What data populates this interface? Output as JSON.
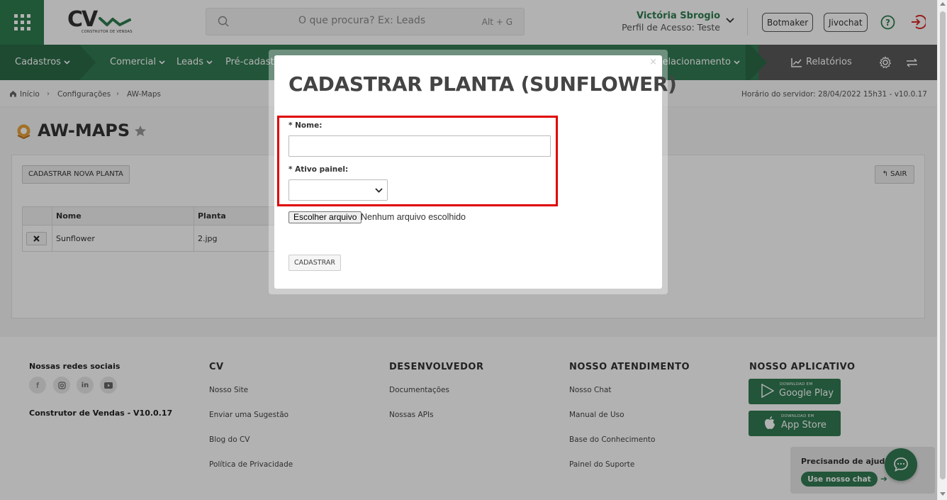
{
  "header": {
    "logo_text": "CV",
    "logo_subtitle": "CONSTRUTOR DE VENDAS",
    "search_placeholder": "O que procura? Ex: Leads",
    "search_shortcut": "Alt + G",
    "user_name": "Victória Sbrogio",
    "user_profile": "Perfil de Acesso: Teste",
    "botmaker_label": "Botmaker",
    "jivochat_label": "Jivochat"
  },
  "nav": {
    "items": [
      "Cadastros",
      "Comercial",
      "Leads",
      "Pré-cadastro",
      "Relacionamento"
    ],
    "relatorios": "Relatórios"
  },
  "breadcrumb": {
    "home": "Início",
    "config": "Configurações",
    "current": "AW-Maps",
    "server_time": "Horário do servidor: 28/04/2022 15h31 - v10.0.17"
  },
  "page": {
    "title": "AW-MAPS",
    "new_button": "CADASTRAR NOVA PLANTA",
    "exit_button": "SAIR",
    "table": {
      "headers": [
        "Nome",
        "Planta"
      ],
      "rows": [
        {
          "nome": "Sunflower",
          "planta": "2.jpg"
        }
      ]
    }
  },
  "modal": {
    "title": "CADASTRAR PLANTA (SUNFLOWER)",
    "close": "×",
    "nome_label": "* Nome:",
    "nome_value": "",
    "ativo_label": "* Ativo painel:",
    "ativo_value": "",
    "file_button": "Escolher arquivo",
    "file_status": "Nenhum arquivo escolhido",
    "submit": "CADASTRAR"
  },
  "footer": {
    "social_title": "Nossas redes sociais",
    "version": "Construtor de Vendas - V10.0.17",
    "cv_title": "CV",
    "cv_links": [
      "Nosso Site",
      "Enviar uma Sugestão",
      "Blog do CV",
      "Política de Privacidade"
    ],
    "dev_title": "DESENVOLVEDOR",
    "dev_links": [
      "Documentações",
      "Nossas APIs"
    ],
    "atend_title": "NOSSO ATENDIMENTO",
    "atend_links": [
      "Nosso Chat",
      "Manual de Uso",
      "Base do Conhecimento",
      "Painel do Suporte"
    ],
    "app_title": "NOSSO APLICATIVO",
    "google_small": "DOWNLOAD EM",
    "google_big": "Google Play",
    "apple_small": "DOWNLOAD EM",
    "apple_big": "App Store",
    "help_title": "Precisando de ajuda?",
    "help_button": "Use nosso chat"
  },
  "colors": {
    "brand_green": "#317a52",
    "highlight_red": "#e00000"
  }
}
